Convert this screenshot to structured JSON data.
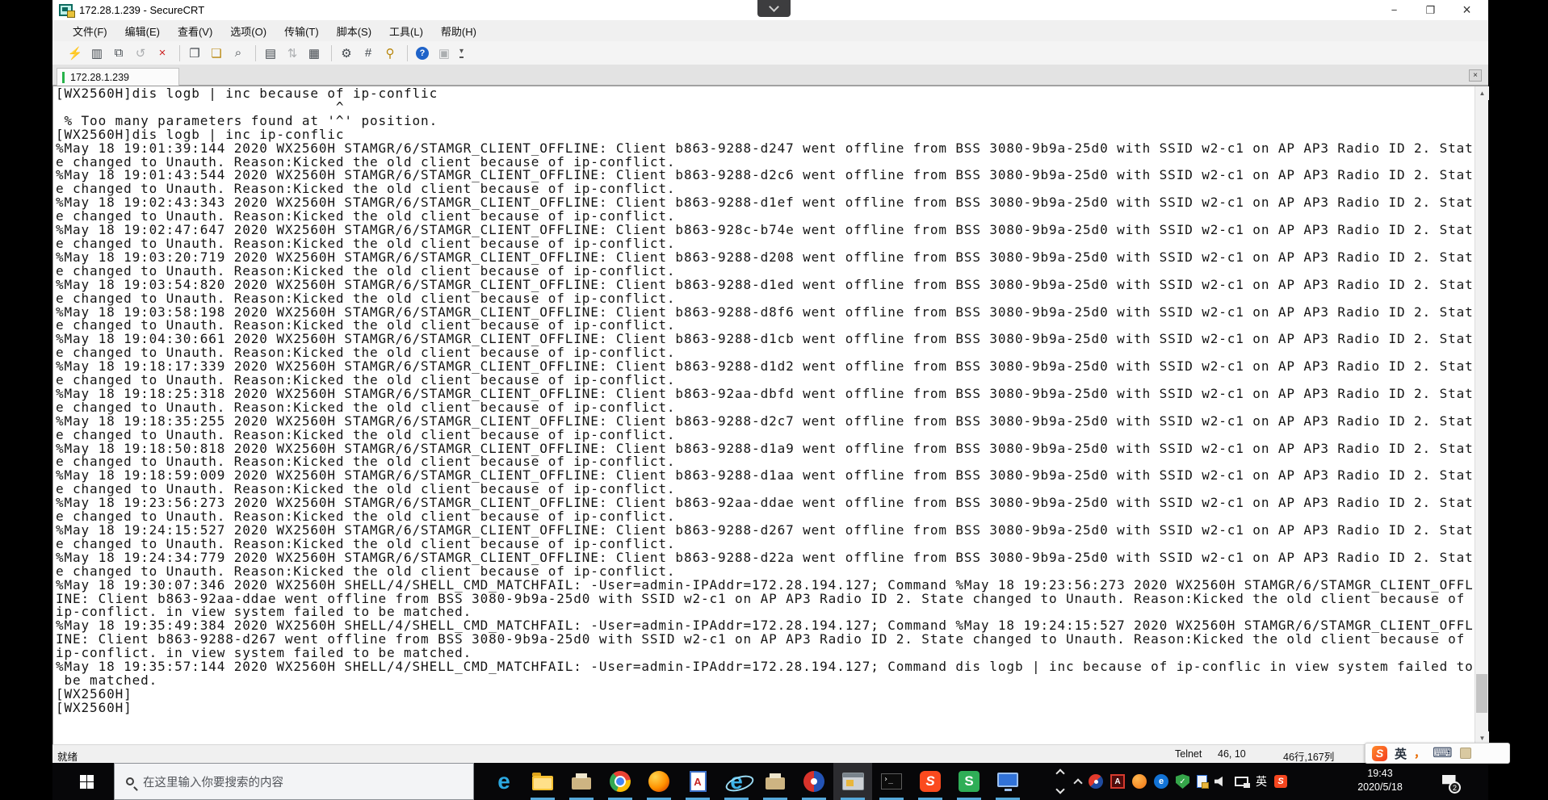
{
  "colors": {
    "tab_connected_green": "#27b24a",
    "taskbar_underline_blue": "#55a8da",
    "sogou_red": "#fb4a1e",
    "terminal_bg": "#ffffff",
    "terminal_text": "#151515",
    "taskbar_bg": "#070709"
  },
  "window": {
    "title": "172.28.1.239 - SecureCRT",
    "menu": [
      "文件(F)",
      "编辑(E)",
      "查看(V)",
      "选项(O)",
      "传输(T)",
      "脚本(S)",
      "工具(L)",
      "帮助(H)"
    ],
    "controls": {
      "minimize": "−",
      "restore": "❐",
      "close": "×"
    },
    "tab_label": "172.28.1.239",
    "tab_close": "×",
    "scroll_up": "▲",
    "scroll_down": "▼",
    "status": {
      "ready": "就绪",
      "protocol": "Telnet",
      "cursor": "46, 10",
      "size": "46行,167列"
    }
  },
  "toolbar": {
    "icons": [
      {
        "name": "quick-connect-icon",
        "glyph": "⚡"
      },
      {
        "name": "session-manager-icon",
        "glyph": "▥"
      },
      {
        "name": "new-session-icon",
        "glyph": "⧉"
      },
      {
        "name": "reconnect-icon",
        "glyph": "↺"
      },
      {
        "name": "disconnect-icon",
        "glyph": "×"
      },
      {
        "name": "copy-icon",
        "glyph": "❐"
      },
      {
        "name": "paste-icon",
        "glyph": "❏"
      },
      {
        "name": "find-icon",
        "glyph": "⌕"
      },
      {
        "name": "print-preview-icon",
        "glyph": "▤"
      },
      {
        "name": "transfer-icon",
        "glyph": "⇅"
      },
      {
        "name": "print-icon",
        "glyph": "▦"
      },
      {
        "name": "session-options-icon",
        "glyph": "⚙"
      },
      {
        "name": "log-session-icon",
        "glyph": "#"
      },
      {
        "name": "key-agent-icon",
        "glyph": "⚲"
      },
      {
        "name": "help-icon",
        "glyph": "?"
      },
      {
        "name": "split-pane-icon",
        "glyph": "▣"
      }
    ],
    "overflow": "▾"
  },
  "terminal": {
    "lines": [
      "[WX2560H]dis logb | inc because of ip-conflic",
      "                                 ^",
      " % Too many parameters found at '^' position.",
      "[WX2560H]dis logb | inc ip-conflic",
      "%May 18 19:01:39:144 2020 WX2560H STAMGR/6/STAMGR_CLIENT_OFFLINE: Client b863-9288-d247 went offline from BSS 3080-9b9a-25d0 with SSID w2-c1 on AP AP3 Radio ID 2. Stat",
      "e changed to Unauth. Reason:Kicked the old client because of ip-conflict.",
      "%May 18 19:01:43:544 2020 WX2560H STAMGR/6/STAMGR_CLIENT_OFFLINE: Client b863-9288-d2c6 went offline from BSS 3080-9b9a-25d0 with SSID w2-c1 on AP AP3 Radio ID 2. Stat",
      "e changed to Unauth. Reason:Kicked the old client because of ip-conflict.",
      "%May 18 19:02:43:343 2020 WX2560H STAMGR/6/STAMGR_CLIENT_OFFLINE: Client b863-9288-d1ef went offline from BSS 3080-9b9a-25d0 with SSID w2-c1 on AP AP3 Radio ID 2. Stat",
      "e changed to Unauth. Reason:Kicked the old client because of ip-conflict.",
      "%May 18 19:02:47:647 2020 WX2560H STAMGR/6/STAMGR_CLIENT_OFFLINE: Client b863-928c-b74e went offline from BSS 3080-9b9a-25d0 with SSID w2-c1 on AP AP3 Radio ID 2. Stat",
      "e changed to Unauth. Reason:Kicked the old client because of ip-conflict.",
      "%May 18 19:03:20:719 2020 WX2560H STAMGR/6/STAMGR_CLIENT_OFFLINE: Client b863-9288-d208 went offline from BSS 3080-9b9a-25d0 with SSID w2-c1 on AP AP3 Radio ID 2. Stat",
      "e changed to Unauth. Reason:Kicked the old client because of ip-conflict.",
      "%May 18 19:03:54:820 2020 WX2560H STAMGR/6/STAMGR_CLIENT_OFFLINE: Client b863-9288-d1ed went offline from BSS 3080-9b9a-25d0 with SSID w2-c1 on AP AP3 Radio ID 2. Stat",
      "e changed to Unauth. Reason:Kicked the old client because of ip-conflict.",
      "%May 18 19:03:58:198 2020 WX2560H STAMGR/6/STAMGR_CLIENT_OFFLINE: Client b863-9288-d8f6 went offline from BSS 3080-9b9a-25d0 with SSID w2-c1 on AP AP3 Radio ID 2. Stat",
      "e changed to Unauth. Reason:Kicked the old client because of ip-conflict.",
      "%May 18 19:04:30:661 2020 WX2560H STAMGR/6/STAMGR_CLIENT_OFFLINE: Client b863-9288-d1cb went offline from BSS 3080-9b9a-25d0 with SSID w2-c1 on AP AP3 Radio ID 2. Stat",
      "e changed to Unauth. Reason:Kicked the old client because of ip-conflict.",
      "%May 18 19:18:17:339 2020 WX2560H STAMGR/6/STAMGR_CLIENT_OFFLINE: Client b863-9288-d1d2 went offline from BSS 3080-9b9a-25d0 with SSID w2-c1 on AP AP3 Radio ID 2. Stat",
      "e changed to Unauth. Reason:Kicked the old client because of ip-conflict.",
      "%May 18 19:18:25:318 2020 WX2560H STAMGR/6/STAMGR_CLIENT_OFFLINE: Client b863-92aa-dbfd went offline from BSS 3080-9b9a-25d0 with SSID w2-c1 on AP AP3 Radio ID 2. Stat",
      "e changed to Unauth. Reason:Kicked the old client because of ip-conflict.",
      "%May 18 19:18:35:255 2020 WX2560H STAMGR/6/STAMGR_CLIENT_OFFLINE: Client b863-9288-d2c7 went offline from BSS 3080-9b9a-25d0 with SSID w2-c1 on AP AP3 Radio ID 2. Stat",
      "e changed to Unauth. Reason:Kicked the old client because of ip-conflict.",
      "%May 18 19:18:50:818 2020 WX2560H STAMGR/6/STAMGR_CLIENT_OFFLINE: Client b863-9288-d1a9 went offline from BSS 3080-9b9a-25d0 with SSID w2-c1 on AP AP3 Radio ID 2. Stat",
      "e changed to Unauth. Reason:Kicked the old client because of ip-conflict.",
      "%May 18 19:18:59:009 2020 WX2560H STAMGR/6/STAMGR_CLIENT_OFFLINE: Client b863-9288-d1aa went offline from BSS 3080-9b9a-25d0 with SSID w2-c1 on AP AP3 Radio ID 2. Stat",
      "e changed to Unauth. Reason:Kicked the old client because of ip-conflict.",
      "%May 18 19:23:56:273 2020 WX2560H STAMGR/6/STAMGR_CLIENT_OFFLINE: Client b863-92aa-ddae went offline from BSS 3080-9b9a-25d0 with SSID w2-c1 on AP AP3 Radio ID 2. Stat",
      "e changed to Unauth. Reason:Kicked the old client because of ip-conflict.",
      "%May 18 19:24:15:527 2020 WX2560H STAMGR/6/STAMGR_CLIENT_OFFLINE: Client b863-9288-d267 went offline from BSS 3080-9b9a-25d0 with SSID w2-c1 on AP AP3 Radio ID 2. Stat",
      "e changed to Unauth. Reason:Kicked the old client because of ip-conflict.",
      "%May 18 19:24:34:779 2020 WX2560H STAMGR/6/STAMGR_CLIENT_OFFLINE: Client b863-9288-d22a went offline from BSS 3080-9b9a-25d0 with SSID w2-c1 on AP AP3 Radio ID 2. Stat",
      "e changed to Unauth. Reason:Kicked the old client because of ip-conflict.",
      "%May 18 19:30:07:346 2020 WX2560H SHELL/4/SHELL_CMD_MATCHFAIL: -User=admin-IPAddr=172.28.194.127; Command %May 18 19:23:56:273 2020 WX2560H STAMGR/6/STAMGR_CLIENT_OFFL",
      "INE: Client b863-92aa-ddae went offline from BSS 3080-9b9a-25d0 with SSID w2-c1 on AP AP3 Radio ID 2. State changed to Unauth. Reason:Kicked the old client because of",
      "ip-conflict. in view system failed to be matched.",
      "%May 18 19:35:49:384 2020 WX2560H SHELL/4/SHELL_CMD_MATCHFAIL: -User=admin-IPAddr=172.28.194.127; Command %May 18 19:24:15:527 2020 WX2560H STAMGR/6/STAMGR_CLIENT_OFFL",
      "INE: Client b863-9288-d267 went offline from BSS 3080-9b9a-25d0 with SSID w2-c1 on AP AP3 Radio ID 2. State changed to Unauth. Reason:Kicked the old client because of",
      "ip-conflict. in view system failed to be matched.",
      "%May 18 19:35:57:144 2020 WX2560H SHELL/4/SHELL_CMD_MATCHFAIL: -User=admin-IPAddr=172.28.194.127; Command dis logb | inc because of ip-conflic in view system failed to",
      " be matched.",
      "[WX2560H]",
      "[WX2560H]"
    ]
  },
  "ime_bar": {
    "logo": "S",
    "mode": "英",
    "punct": "，",
    "keyboard": "⌨"
  },
  "taskbar": {
    "search_placeholder": "在这里输入你要搜索的内容",
    "apps": [
      "edge",
      "file-explorer",
      "printer",
      "chrome",
      "firefox",
      "word-viewer",
      "internet-explorer",
      "printer-2",
      "media-player",
      "remote-viewer",
      "command-prompt",
      "sogou-pinyin",
      "green-s-app",
      "my-computer"
    ],
    "edge_glyph": "e",
    "ie_glyph": "e",
    "word_glyph": "A",
    "cmd_glyph": "›_",
    "sogou_glyph": "S",
    "green_s_glyph": "S",
    "tray_e_glyph": "e",
    "tray_shield_glyph": "✓",
    "tray_adobe_glyph": "A",
    "tray_sogou_glyph": "S",
    "ime_indicator": "英",
    "clock_time": "19:43",
    "clock_date": "2020/5/18",
    "notification_count": "2"
  }
}
